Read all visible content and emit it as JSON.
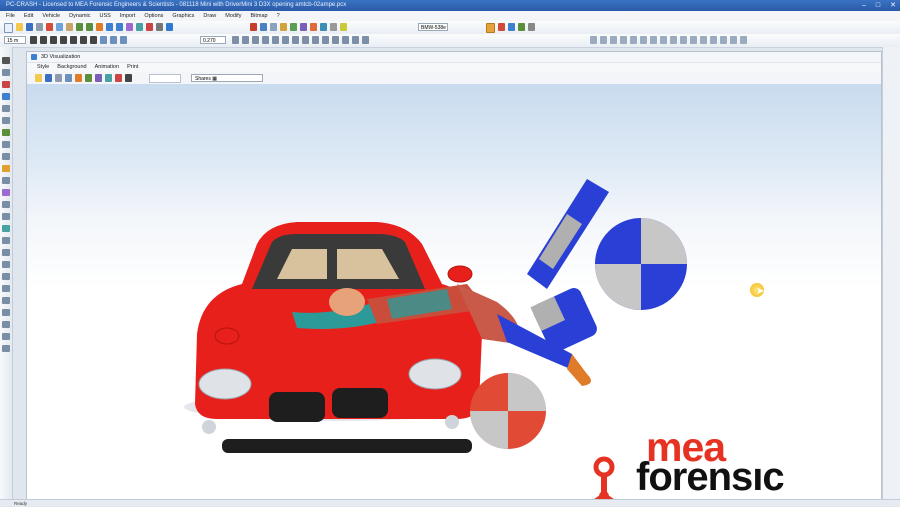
{
  "app_title": "PC-CRASH - Licensed to MEA Forensic Engineers & Scientists - 081118 Mini with DriverMini 3 D3X opening amtcb-02ampe.pcx",
  "menu": [
    "File",
    "Edit",
    "Vehicle",
    "Dynamic",
    "USS",
    "Import",
    "Options",
    "Graphics",
    "Draw",
    "Modify",
    "Bitmap",
    "?"
  ],
  "toolbar": {
    "zoom": "15 m",
    "percent": "0.270",
    "vehicle": "BMW-538e"
  },
  "viz_window": {
    "title": "3D Visualization",
    "menu": [
      "Style",
      "Background",
      "Animation",
      "Print"
    ],
    "shares_select": "Shares ▦"
  },
  "status_text": "Ready",
  "logo": {
    "top": "mea",
    "bottom": "forensıc"
  },
  "colors": {
    "car": "#e8201c",
    "accent_red": "#e63222",
    "dummy_blue": "#2a3fd6"
  }
}
